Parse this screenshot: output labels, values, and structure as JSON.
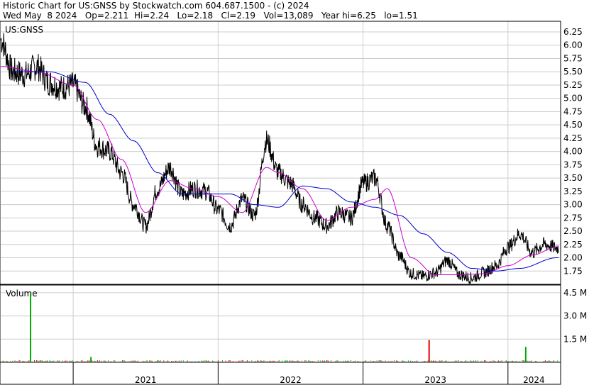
{
  "header": {
    "line1": "Historic Chart for US:GNSS by Stockwatch.com 604.687.1500 - (c) 2024",
    "line2": "Wed May  8 2024   Op=2.211  Hi=2.24   Lo=2.18   Cl=2.19   Vol=13,089   Year hi=6.25   lo=1.51"
  },
  "colors": {
    "price": "#000000",
    "ma_short": "#cc00cc",
    "ma_long": "#0000cc",
    "volume_up": "#00aa00",
    "volume_down": "#dd0000",
    "grid": "#cccccc"
  },
  "chart_data": [
    {
      "type": "line",
      "title": "US:GNSS",
      "x_range": [
        "2020-07",
        "2024-05"
      ],
      "ylim": [
        1.5,
        6.45
      ],
      "y_ticks": [
        "6.25",
        "6.00",
        "5.75",
        "5.50",
        "5.25",
        "5.00",
        "4.75",
        "4.50",
        "4.25",
        "4.00",
        "3.75",
        "3.50",
        "3.25",
        "3.00",
        "2.75",
        "2.50",
        "2.25",
        "2.00",
        "1.75"
      ],
      "grid": true,
      "series": [
        {
          "key": "price",
          "x": [
            "2020-07",
            "2020-08",
            "2020-09",
            "2020-10",
            "2020-11",
            "2020-12",
            "2021-01",
            "2021-02",
            "2021-03",
            "2021-04",
            "2021-05",
            "2021-06",
            "2021-07",
            "2021-08",
            "2021-09",
            "2021-10",
            "2021-11",
            "2021-12",
            "2022-01",
            "2022-02",
            "2022-03",
            "2022-04",
            "2022-05",
            "2022-06",
            "2022-07",
            "2022-08",
            "2022-09",
            "2022-10",
            "2022-11",
            "2022-12",
            "2023-01",
            "2023-02",
            "2023-03",
            "2023-04",
            "2023-05",
            "2023-06",
            "2023-07",
            "2023-08",
            "2023-09",
            "2023-10",
            "2023-11",
            "2023-12",
            "2024-01",
            "2024-02",
            "2024-03",
            "2024-04",
            "2024-05"
          ],
          "values": [
            6.1,
            5.5,
            5.45,
            5.6,
            5.3,
            5.2,
            5.25,
            4.85,
            4.1,
            4.0,
            3.6,
            3.0,
            2.6,
            3.3,
            3.7,
            3.2,
            3.3,
            3.25,
            2.9,
            2.6,
            3.1,
            2.8,
            4.2,
            3.6,
            3.4,
            3.0,
            2.75,
            2.6,
            2.85,
            2.75,
            3.4,
            3.5,
            2.6,
            2.04,
            1.7,
            1.65,
            1.72,
            1.95,
            1.68,
            1.62,
            1.72,
            1.85,
            2.2,
            2.45,
            2.1,
            2.25,
            2.19
          ]
        },
        {
          "key": "ma_short",
          "x": [
            "2020-07",
            "2020-10",
            "2021-01",
            "2021-03",
            "2021-05",
            "2021-07",
            "2021-09",
            "2021-11",
            "2022-01",
            "2022-03",
            "2022-05",
            "2022-06",
            "2022-08",
            "2022-10",
            "2022-12",
            "2023-02",
            "2023-03",
            "2023-05",
            "2023-07",
            "2023-09",
            "2023-11",
            "2024-01",
            "2024-03",
            "2024-05"
          ],
          "values": [
            5.6,
            5.5,
            5.25,
            4.6,
            3.85,
            2.85,
            3.45,
            3.3,
            3.15,
            2.85,
            3.7,
            3.6,
            3.3,
            2.7,
            2.95,
            3.1,
            3.3,
            2.0,
            1.68,
            1.68,
            1.7,
            1.85,
            2.05,
            2.2
          ]
        },
        {
          "key": "ma_long",
          "x": [
            "2020-08",
            "2020-11",
            "2021-02",
            "2021-04",
            "2021-06",
            "2021-08",
            "2021-10",
            "2021-12",
            "2022-02",
            "2022-04",
            "2022-06",
            "2022-08",
            "2022-10",
            "2022-12",
            "2023-02",
            "2023-04",
            "2023-06",
            "2023-08",
            "2023-10",
            "2023-12",
            "2024-02",
            "2024-05"
          ],
          "values": [
            5.5,
            5.5,
            5.3,
            4.7,
            4.2,
            3.6,
            3.2,
            3.2,
            3.2,
            3.0,
            2.95,
            3.35,
            3.3,
            3.05,
            2.95,
            2.8,
            2.45,
            2.1,
            1.8,
            1.75,
            1.8,
            2.0
          ]
        }
      ]
    },
    {
      "type": "bar",
      "title": "Volume",
      "y_ticks": [
        "4.5 M",
        "3.0 M",
        "1.5 M"
      ],
      "ylim": [
        0,
        5.0
      ],
      "unit": "M",
      "x_ticks": [
        "2021",
        "2022",
        "2023",
        "2024"
      ],
      "spikes": [
        {
          "x": "2020-09",
          "value": 4.45,
          "color": "up"
        },
        {
          "x": "2021-02",
          "value": 0.35,
          "color": "up"
        },
        {
          "x": "2023-06",
          "value": 1.45,
          "color": "down"
        },
        {
          "x": "2024-02",
          "value": 1.0,
          "color": "up"
        }
      ],
      "baseline_level": 0.12
    }
  ]
}
